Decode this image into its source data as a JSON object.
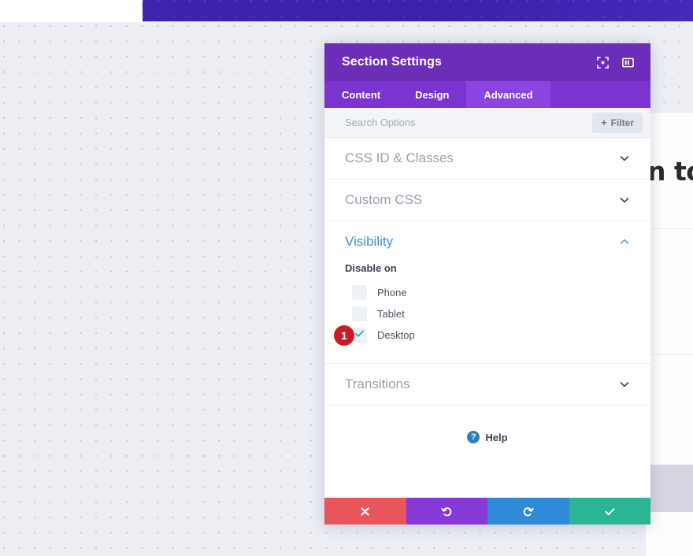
{
  "background": {
    "page_heading_fragment": "n tou",
    "banner_color": "#3b21ab",
    "canvas_color": "#eceef4"
  },
  "modal": {
    "title": "Section Settings",
    "header_color": "#6c2eb9",
    "header_icons": [
      {
        "name": "focus-icon",
        "label": "Focus"
      },
      {
        "name": "layout-panel-icon",
        "label": "Layout"
      }
    ],
    "tabs": [
      {
        "label": "Content",
        "active": false
      },
      {
        "label": "Design",
        "active": false
      },
      {
        "label": "Advanced",
        "active": true
      }
    ],
    "search": {
      "placeholder": "Search Options",
      "value": ""
    },
    "filter_button": {
      "plus": "+",
      "label": "Filter"
    },
    "sections": [
      {
        "title": "CSS ID & Classes",
        "open": false
      },
      {
        "title": "Custom CSS",
        "open": false
      }
    ],
    "visibility": {
      "title": "Visibility",
      "open": true,
      "accent_color": "#3e8fd0",
      "group_label": "Disable on",
      "options": [
        {
          "label": "Phone",
          "checked": false,
          "badge": null
        },
        {
          "label": "Tablet",
          "checked": false,
          "badge": null
        },
        {
          "label": "Desktop",
          "checked": true,
          "badge": "1"
        }
      ]
    },
    "transitions": {
      "title": "Transitions",
      "open": false
    },
    "help": {
      "icon_glyph": "?",
      "label": "Help"
    },
    "footer_buttons": [
      {
        "name": "close",
        "glyph": "close-icon",
        "color": "#e8555a"
      },
      {
        "name": "undo",
        "glyph": "undo-icon",
        "color": "#8639d6"
      },
      {
        "name": "redo",
        "glyph": "redo-icon",
        "color": "#2f8ad8"
      },
      {
        "name": "save",
        "glyph": "check-icon",
        "color": "#2bb596"
      }
    ]
  }
}
